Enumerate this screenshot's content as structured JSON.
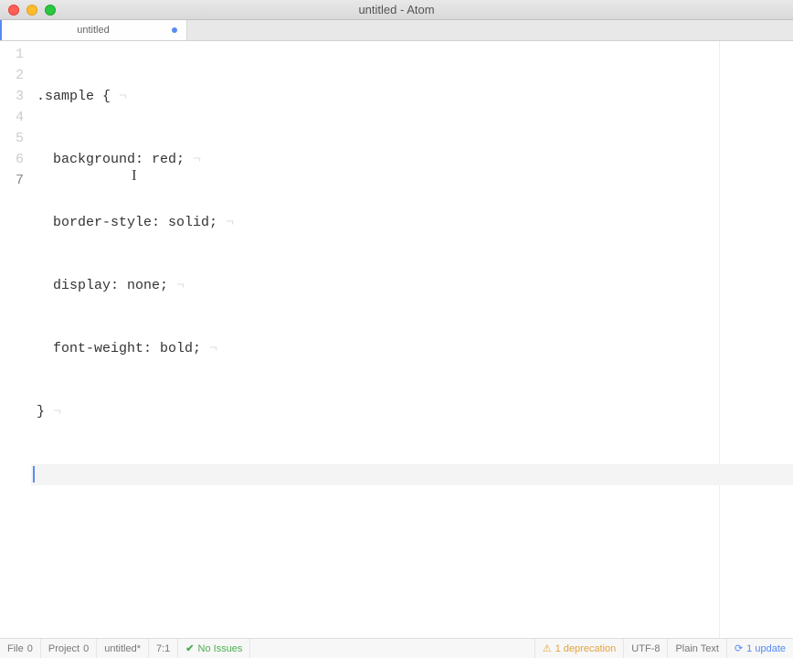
{
  "window": {
    "title": "untitled - Atom"
  },
  "tab": {
    "name": "untitled",
    "dirty": true
  },
  "editor": {
    "lines": [
      ".sample {",
      "  background: red;",
      "  border-style: solid;",
      "  display: none;",
      "  font-weight: bold;",
      "}",
      ""
    ],
    "cursor_line": 7
  },
  "status": {
    "file": {
      "label": "File",
      "count": "0"
    },
    "project": {
      "label": "Project",
      "count": "0"
    },
    "path": "untitled*",
    "position": "7:1",
    "issues": "No Issues",
    "deprecation": "1 deprecation",
    "encoding": "UTF-8",
    "grammar": "Plain Text",
    "update": "1 update"
  }
}
